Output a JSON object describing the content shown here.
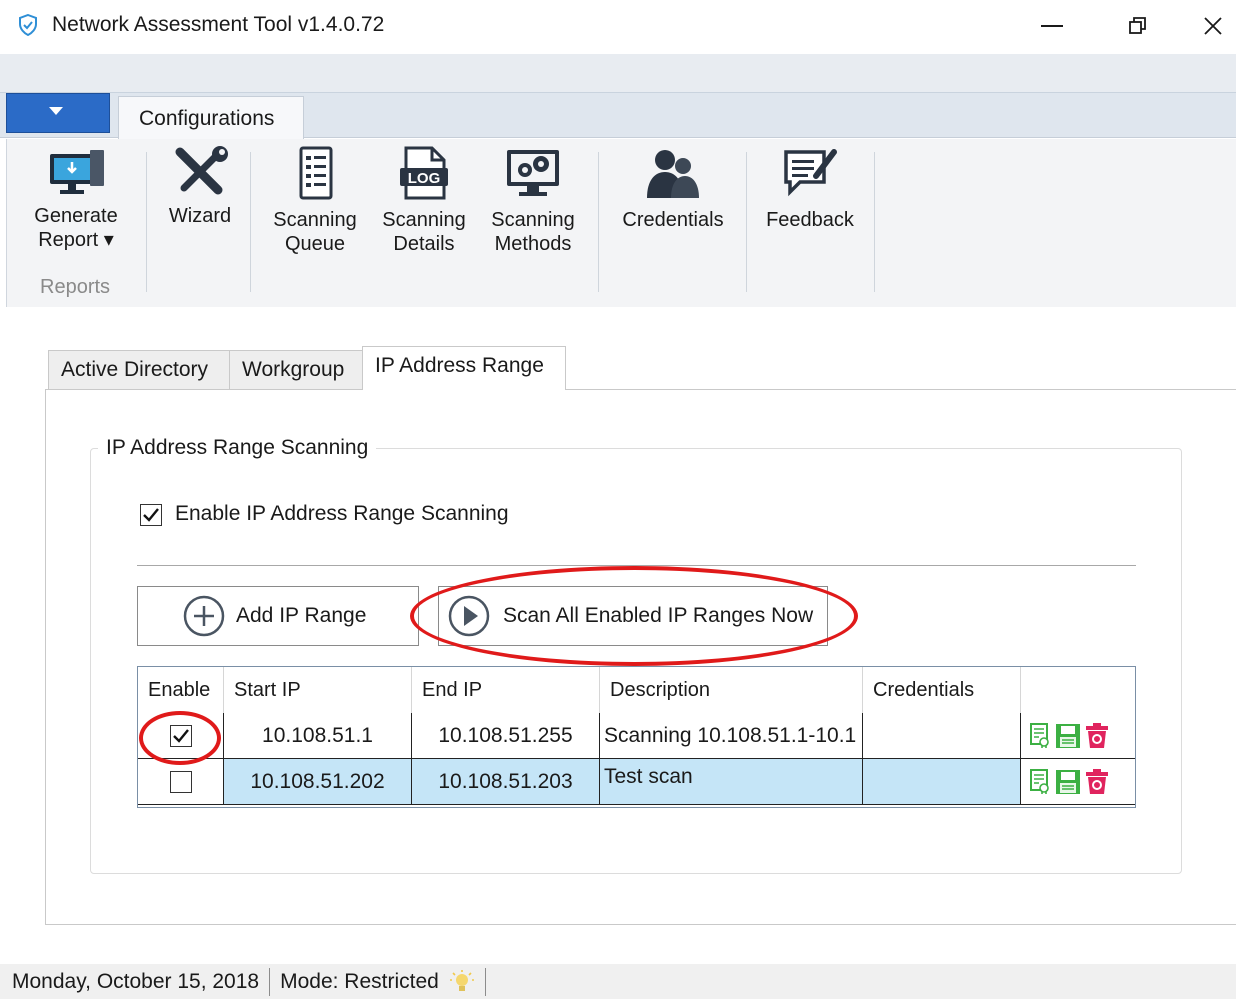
{
  "window": {
    "title": "Network Assessment Tool v1.4.0.72",
    "minimize_icon": "minimize-icon",
    "maximize_icon": "restore-icon",
    "close_icon": "close-icon"
  },
  "ribbon": {
    "tab": "Configurations",
    "buttons": [
      {
        "line1": "Generate",
        "line2": "Report ▾",
        "icon": "monitor-report-icon"
      },
      {
        "line1": "Wizard",
        "line2": "",
        "icon": "tools-wizard-icon"
      },
      {
        "line1": "Scanning",
        "line2": "Queue",
        "icon": "queue-list-icon"
      },
      {
        "line1": "Scanning",
        "line2": "Details",
        "icon": "log-file-icon"
      },
      {
        "line1": "Scanning",
        "line2": "Methods",
        "icon": "gears-monitor-icon"
      },
      {
        "line1": "Credentials",
        "line2": "",
        "icon": "users-icon"
      },
      {
        "line1": "Feedback",
        "line2": "",
        "icon": "feedback-icon"
      }
    ],
    "group_label": "Reports"
  },
  "tabs": [
    "Active Directory",
    "Workgroup",
    "IP Address Range"
  ],
  "active_tab": "IP Address Range",
  "section": {
    "title": "IP Address Range Scanning",
    "enable_label": "Enable IP Address Range Scanning",
    "enable_checked": true,
    "add_button": "Add IP Range",
    "scan_button": "Scan All Enabled IP Ranges Now"
  },
  "grid": {
    "columns": [
      "Enable",
      "Start IP",
      "End IP",
      "Description",
      "Credentials",
      ""
    ],
    "rows": [
      {
        "enabled": true,
        "start_ip": "10.108.51.1",
        "end_ip": "10.108.51.255",
        "description": "Scanning 10.108.51.1-10.1",
        "credentials": ""
      },
      {
        "enabled": false,
        "start_ip": "10.108.51.202",
        "end_ip": "10.108.51.203",
        "description": "Test scan",
        "credentials": ""
      }
    ],
    "row_action_icons": [
      "certificate-icon",
      "save-icon",
      "delete-icon"
    ]
  },
  "status": {
    "date": "Monday, October 15, 2018",
    "mode": "Mode: Restricted",
    "mode_icon": "lightbulb-icon"
  },
  "colors": {
    "file_tab": "#2b6bc7",
    "highlight": "#e01a1a",
    "selected_row": "#c5e5f7"
  }
}
